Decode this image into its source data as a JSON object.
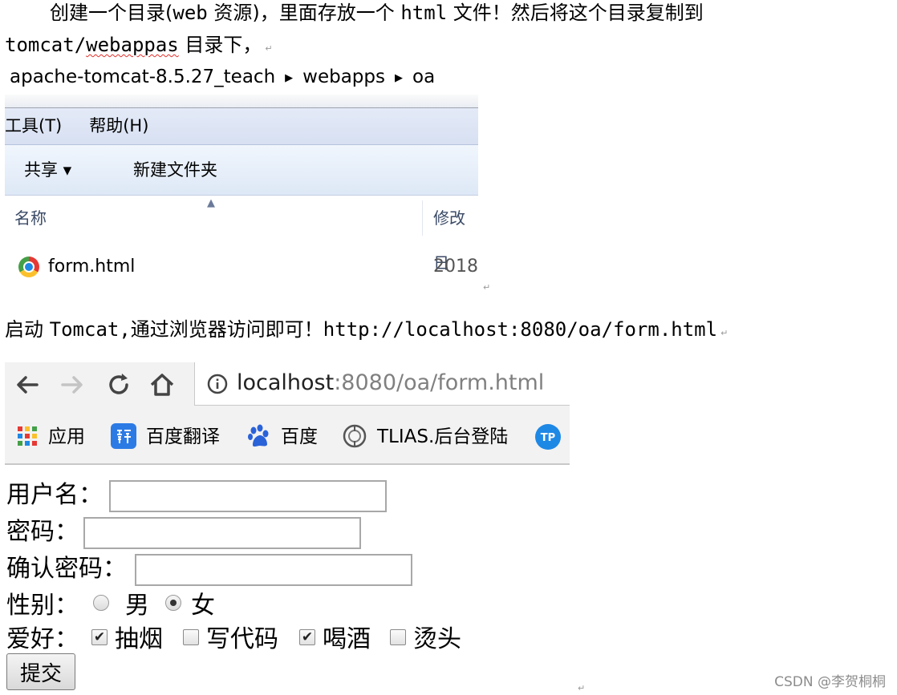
{
  "doc": {
    "intro_part1": "创建一个目录(",
    "intro_web": "web",
    "intro_part2": " 资源)，里面存放一个 ",
    "intro_html": "html",
    "intro_part3": " 文件！然后将这个目录复制到",
    "intro_line2_a": "tomcat/",
    "intro_line2_b": "webappas",
    "intro_line2_c": " 目录下，",
    "start_text": "启动 ",
    "start_tomcat": "Tomcat,",
    "start_text2": "通过浏览器访问即可！",
    "start_url": "http://localhost:8080/oa/form.html",
    "para_mark": "↵"
  },
  "explorer": {
    "path": [
      "apache-tomcat-8.5.27_teach",
      "webapps",
      "oa"
    ],
    "menu": [
      "工具(T)",
      "帮助(H)"
    ],
    "toolbar": {
      "share": "共享 ▾",
      "new_folder": "新建文件夹"
    },
    "columns": {
      "name": "名称",
      "modified": "修改日"
    },
    "file": {
      "name": "form.html",
      "date": "2018"
    }
  },
  "browser": {
    "url_host": "localhost",
    "url_rest": ":8080/oa/form.html",
    "bookmarks": [
      {
        "label": "应用",
        "icon": "apps-grid-icon"
      },
      {
        "label": "百度翻译",
        "icon": "translate-icon"
      },
      {
        "label": "百度",
        "icon": "baidu-paw-icon"
      },
      {
        "label": "TLIAS.后台登陆",
        "icon": "tlias-icon"
      }
    ]
  },
  "form": {
    "username_label": "用户名：",
    "password_label": "密码：",
    "confirm_label": "确认密码：",
    "gender_label": "性别：",
    "gender_options": [
      "男",
      "女"
    ],
    "gender_selected": "女",
    "hobby_label": "爱好：",
    "hobbies": [
      {
        "label": "抽烟",
        "checked": true
      },
      {
        "label": "写代码",
        "checked": false
      },
      {
        "label": "喝酒",
        "checked": true
      },
      {
        "label": "烫头",
        "checked": false
      }
    ],
    "submit_label": "提交"
  },
  "watermark": "CSDN @李贺桐桐"
}
